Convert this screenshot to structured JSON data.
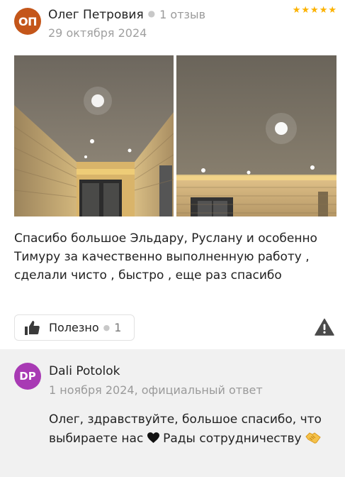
{
  "review": {
    "author_initials": "ОП",
    "author_name": "Олег Петровия",
    "reviews_count": "1 отзыв",
    "date": "29 октября 2024",
    "rating": 5,
    "text": "Спасибо большое Эльдару, Руслану и особенно Тимуру за качественно выполненную работу , сделали чисто , быстро , еще раз спасибо",
    "useful_label": "Полезно",
    "useful_count": "1",
    "avatar_color": "#c4561a"
  },
  "photos": [
    {
      "icon": "photo-ceiling-corridor"
    },
    {
      "icon": "photo-ceiling-room"
    }
  ],
  "answer": {
    "initials": "DP",
    "name": "Dali Potolok",
    "meta": "1 ноября 2024, официальный ответ",
    "text_before_heart": "Олег, здравствуйте, большое спасибо, что выбираете нас",
    "text_after_heart": "Рады сотрудничеству",
    "heart_icon": "black-heart-icon",
    "handshake_icon": "handshake-icon",
    "avatar_color": "#a83ab4"
  },
  "colors": {
    "star": "#fcb200",
    "answer_bg": "#f1f1f1",
    "muted": "#9a9a9a"
  }
}
